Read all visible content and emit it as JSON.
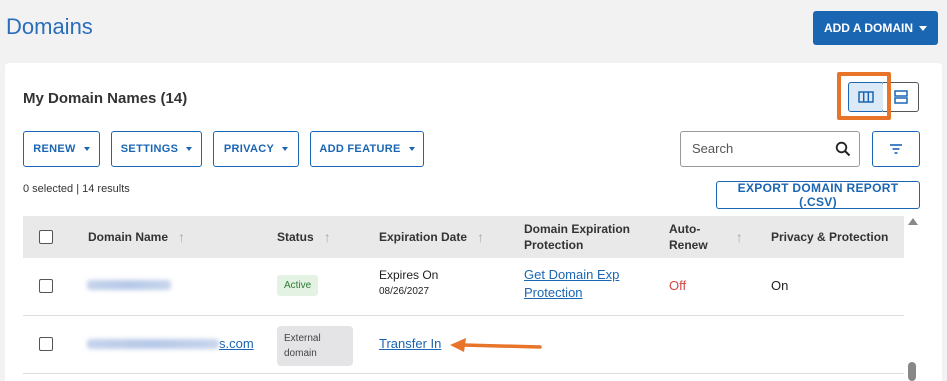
{
  "header": {
    "title": "Domains",
    "add_domain_label": "ADD A DOMAIN"
  },
  "card": {
    "title": "My Domain Names (14)"
  },
  "view_toggle": {
    "columns_icon": "columns-icon",
    "rows_icon": "rows-icon",
    "active": "columns"
  },
  "toolbar": {
    "filters": [
      {
        "label": "RENEW"
      },
      {
        "label": "SETTINGS"
      },
      {
        "label": "PRIVACY"
      },
      {
        "label": "ADD FEATURE"
      }
    ],
    "search_placeholder": "Search",
    "search_icon": "search-icon",
    "filter_icon": "filter-icon"
  },
  "results_text": "0 selected | 14 results",
  "export_label": "EXPORT DOMAIN REPORT (.CSV)",
  "table": {
    "columns": {
      "domain_name": "Domain Name",
      "status": "Status",
      "expiration_date": "Expiration Date",
      "protection_line1": "Domain Expiration",
      "protection_line2": "Protection",
      "auto_renew_line1": "Auto-",
      "auto_renew_line2": "Renew",
      "privacy": "Privacy & Protection"
    },
    "rows": [
      {
        "domain": "",
        "status": "Active",
        "expires_label": "Expires On",
        "expires_date": "08/26/2027",
        "protection_line1": "Get Domain Exp",
        "protection_line2": "Protection",
        "auto_renew": "Off",
        "privacy": "On"
      },
      {
        "domain_suffix": "s.com",
        "status_line1": "External",
        "status_line2": "domain",
        "expiration_link": "Transfer In"
      }
    ]
  },
  "colors": {
    "brand_blue": "#1a66b3",
    "title_blue": "#2a6ebb",
    "annotation_orange": "#e8742a",
    "off_red": "#d14747"
  }
}
